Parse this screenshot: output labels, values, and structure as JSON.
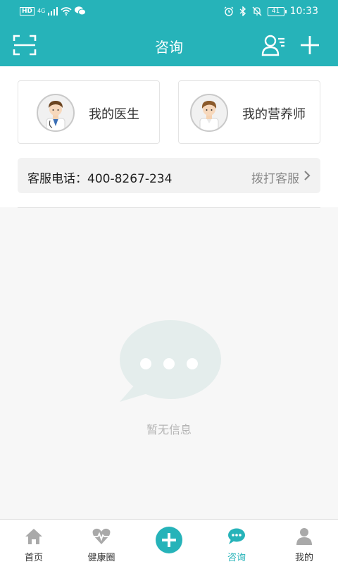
{
  "status_bar": {
    "hd": "HD",
    "network": "4G",
    "battery": "41",
    "time": "10:33",
    "icons": [
      "signal-icon",
      "wifi-icon",
      "wechat-icon",
      "alarm-icon",
      "bluetooth-icon",
      "mute-icon",
      "battery-icon"
    ]
  },
  "header": {
    "title": "咨询",
    "icons": [
      "scan-icon",
      "contacts-icon",
      "plus-icon"
    ]
  },
  "cards": [
    {
      "label": "我的医生",
      "icon": "doctor-avatar-icon"
    },
    {
      "label": "我的营养师",
      "icon": "nutritionist-avatar-icon"
    }
  ],
  "hotline": {
    "text": "客服电话：400-8267-234",
    "action": "拨打客服",
    "icon": "chevron-right-icon"
  },
  "empty_state": {
    "text": "暂无信息",
    "icon": "chat-bubble-icon"
  },
  "tabbar": {
    "items": [
      {
        "label": "首页",
        "icon": "home-icon"
      },
      {
        "label": "健康圈",
        "icon": "heart-pulse-icon"
      },
      {
        "label": "",
        "icon": "add-circle-icon"
      },
      {
        "label": "咨询",
        "icon": "chat-icon"
      },
      {
        "label": "我的",
        "icon": "user-icon"
      }
    ],
    "active": "咨询"
  },
  "colors": {
    "brand": "#26b3b9",
    "empty_icon": "#e4edec",
    "inactive_icon": "#a9a9a9"
  }
}
